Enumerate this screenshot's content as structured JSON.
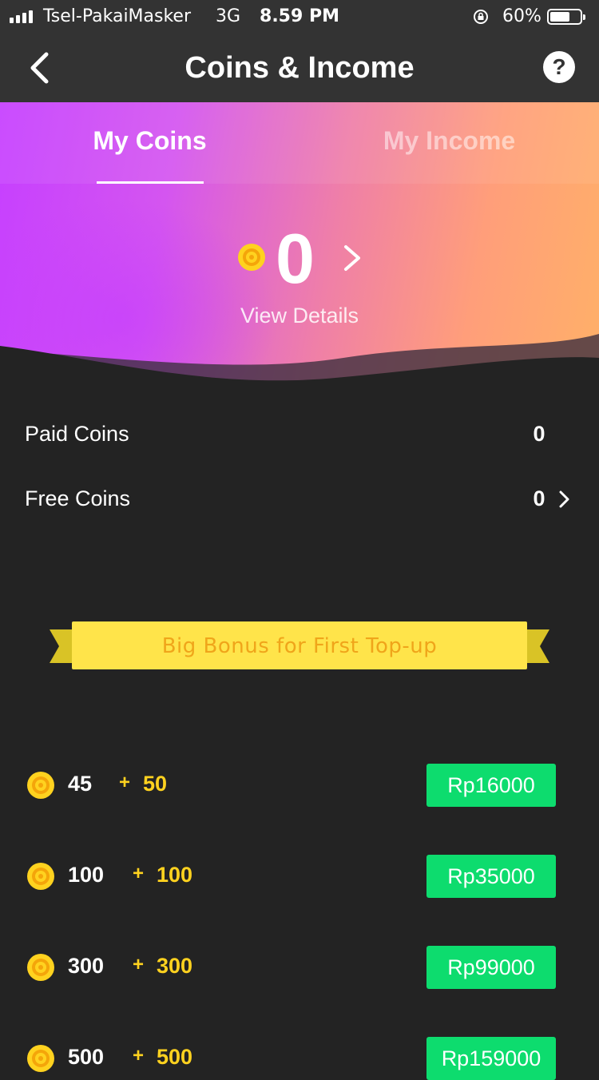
{
  "status_bar": {
    "carrier": "Tsel-PakaiMasker",
    "network": "3G",
    "time": "8.59 PM",
    "battery": "60%",
    "battery_level": 0.6,
    "icons": [
      "signal-icon",
      "rotation-lock-icon",
      "battery-icon"
    ]
  },
  "nav": {
    "title": "Coins & Income",
    "back_icon": "chevron-left-icon",
    "help_label": "?"
  },
  "tabs": [
    {
      "label": "My Coins",
      "active": true
    },
    {
      "label": "My Income",
      "active": false
    }
  ],
  "balance": {
    "value": "0",
    "details_label": "View Details"
  },
  "coin_breakdown": [
    {
      "label": "Paid Coins",
      "value": "0"
    },
    {
      "label": "Free Coins",
      "value": "0"
    }
  ],
  "banner": {
    "text": "Big Bonus for First Top-up"
  },
  "packages": [
    {
      "amount": "45",
      "plus": "+",
      "bonus": "50",
      "price": "Rp16000"
    },
    {
      "amount": "100",
      "plus": "+",
      "bonus": "100",
      "price": "Rp35000"
    },
    {
      "amount": "300",
      "plus": "+",
      "bonus": "300",
      "price": "Rp99000"
    },
    {
      "amount": "500",
      "plus": "+",
      "bonus": "500",
      "price": "Rp159000"
    }
  ],
  "colors": {
    "background": "#232323",
    "header": "#333333",
    "accent_green": "#0ddc6e",
    "bonus_yellow": "#ffd21f",
    "banner_yellow": "#ffe44a",
    "banner_text": "#f0a51a",
    "gradient_start": "#c63fff",
    "gradient_end": "#ffb068"
  }
}
